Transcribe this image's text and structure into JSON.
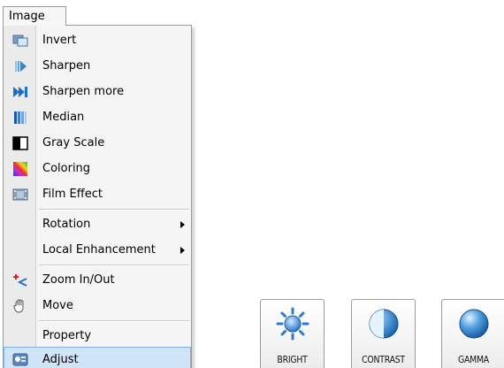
{
  "menu": {
    "title": "Image",
    "items": [
      {
        "label": "Invert",
        "icon": "invert-icon"
      },
      {
        "label": "Sharpen",
        "icon": "sharpen-icon"
      },
      {
        "label": "Sharpen more",
        "icon": "sharpen-more-icon"
      },
      {
        "label": "Median",
        "icon": "median-icon"
      },
      {
        "label": "Gray Scale",
        "icon": "gray-scale-icon"
      },
      {
        "label": "Coloring",
        "icon": "coloring-icon"
      },
      {
        "label": "Film Effect",
        "icon": "film-effect-icon"
      },
      {
        "label": "Rotation",
        "icon": "",
        "submenu": true
      },
      {
        "label": "Local Enhancement",
        "icon": "",
        "submenu": true
      },
      {
        "label": "Zoom In/Out",
        "icon": "zoom-icon"
      },
      {
        "label": "Move",
        "icon": "hand-move-icon"
      },
      {
        "label": "Property",
        "icon": ""
      },
      {
        "label": "Adjust",
        "icon": "adjust-icon",
        "highlighted": true
      }
    ]
  },
  "adjust_buttons": [
    {
      "label": "BRIGHT",
      "icon": "brightness-sun-icon"
    },
    {
      "label": "CONTRAST",
      "icon": "contrast-icon"
    },
    {
      "label": "GAMMA",
      "icon": "gamma-sphere-icon"
    }
  ],
  "colors": {
    "highlight": "#cfe4f7",
    "highlight_border": "#7fb2e3",
    "accent_blue": "#1f7ed8"
  }
}
